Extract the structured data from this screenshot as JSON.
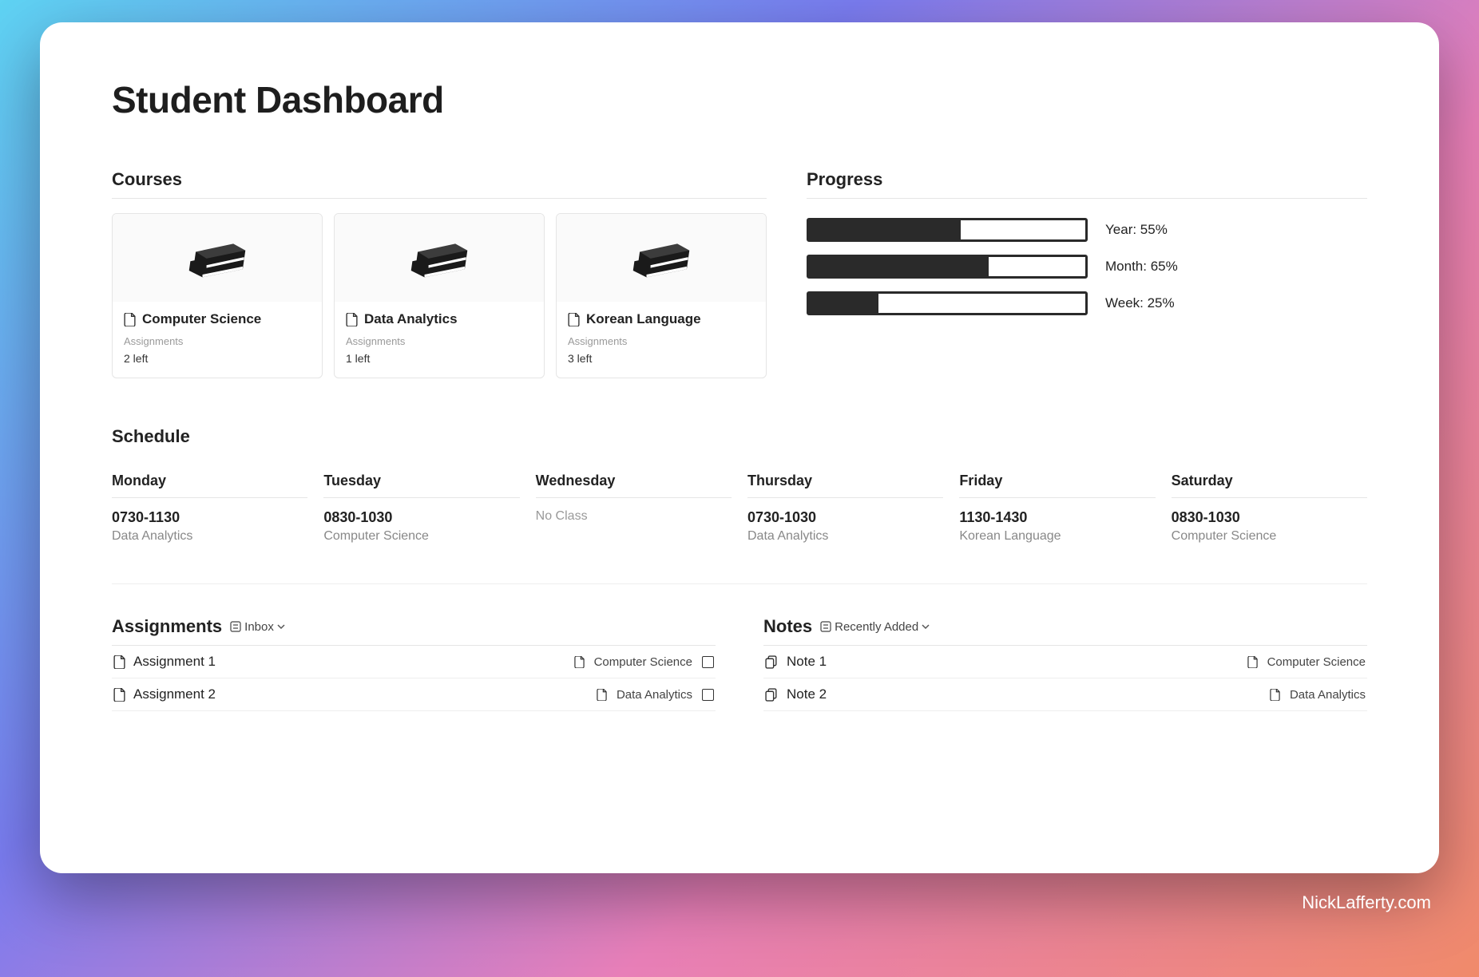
{
  "page_title": "Student Dashboard",
  "watermark": "NickLafferty.com",
  "sections": {
    "courses_title": "Courses",
    "progress_title": "Progress",
    "schedule_title": "Schedule",
    "assignments_title": "Assignments",
    "notes_title": "Notes"
  },
  "courses": [
    {
      "title": "Computer Science",
      "meta_label": "Assignments",
      "meta_value": "2 left"
    },
    {
      "title": "Data Analytics",
      "meta_label": "Assignments",
      "meta_value": "1 left"
    },
    {
      "title": "Korean Language",
      "meta_label": "Assignments",
      "meta_value": "3 left"
    }
  ],
  "progress": [
    {
      "label": "Year: 55%",
      "percent": 55
    },
    {
      "label": "Month: 65%",
      "percent": 65
    },
    {
      "label": "Week: 25%",
      "percent": 25
    }
  ],
  "schedule": [
    {
      "day": "Monday",
      "time": "0730-1130",
      "course": "Data Analytics",
      "no_class": false
    },
    {
      "day": "Tuesday",
      "time": "0830-1030",
      "course": "Computer Science",
      "no_class": false
    },
    {
      "day": "Wednesday",
      "time": "",
      "course": "No Class",
      "no_class": true
    },
    {
      "day": "Thursday",
      "time": "0730-1030",
      "course": "Data Analytics",
      "no_class": false
    },
    {
      "day": "Friday",
      "time": "1130-1430",
      "course": "Korean Language",
      "no_class": false
    },
    {
      "day": "Saturday",
      "time": "0830-1030",
      "course": "Computer Science",
      "no_class": false
    }
  ],
  "assignments_view": "Inbox",
  "assignments": [
    {
      "title": "Assignment 1",
      "course": "Computer Science"
    },
    {
      "title": "Assignment 2",
      "course": "Data Analytics"
    }
  ],
  "notes_view": "Recently Added",
  "notes": [
    {
      "title": "Note 1",
      "course": "Computer Science"
    },
    {
      "title": "Note 2",
      "course": "Data Analytics"
    }
  ]
}
